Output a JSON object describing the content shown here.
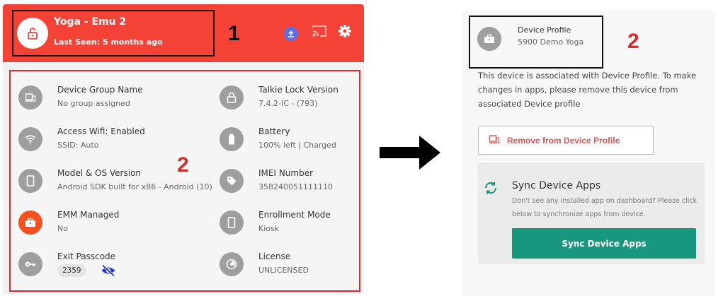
{
  "header": {
    "device_name": "Yoga - Emu 2",
    "last_seen": "Last Seen: 5 months ago",
    "bg_color": "#f44336",
    "icons": [
      "lock-icon",
      "upload-icon",
      "cast-icon",
      "gear-icon"
    ]
  },
  "annotations": {
    "header_number": "1",
    "details_number": "2",
    "profile_number": "2"
  },
  "details": {
    "left": [
      {
        "icon": "device-group-icon",
        "label": "Device Group Name",
        "value": "No group assigned"
      },
      {
        "icon": "wifi-icon",
        "label": "Access Wifi: Enabled",
        "value": "SSID: Auto"
      },
      {
        "icon": "phone-icon",
        "label": "Model & OS Version",
        "value": "Android SDK built for x86 - Android (10)"
      },
      {
        "icon": "briefcase-icon",
        "label": "EMM Managed",
        "value": "No"
      },
      {
        "icon": "key-icon",
        "label": "Exit Passcode",
        "value": "2359"
      }
    ],
    "right": [
      {
        "icon": "lock-icon",
        "label": "Talkie Lock Version",
        "value": "7.4.2-IC - (793)"
      },
      {
        "icon": "battery-icon",
        "label": "Battery",
        "value": "100% left | Charged"
      },
      {
        "icon": "tag-icon",
        "label": "IMEI Number",
        "value": "358240051111110"
      },
      {
        "icon": "phone-icon",
        "label": "Enrollment Mode",
        "value": "Kiosk"
      },
      {
        "icon": "license-icon",
        "label": "License",
        "value": "UNLICENSED"
      }
    ]
  },
  "profile": {
    "title": "Device Profile",
    "name": "5900 Demo Yoga",
    "note": "This device is associated with Device Profile. To make changes in apps, please remove this device from associated Device profile",
    "remove_label": "Remove from Device Profile"
  },
  "sync": {
    "title": "Sync Device Apps",
    "description": "Don't see any installed app on dashboard? Please click below to synchronize apps from device.",
    "button_label": "Sync Device Apps",
    "button_color": "#17977e"
  }
}
